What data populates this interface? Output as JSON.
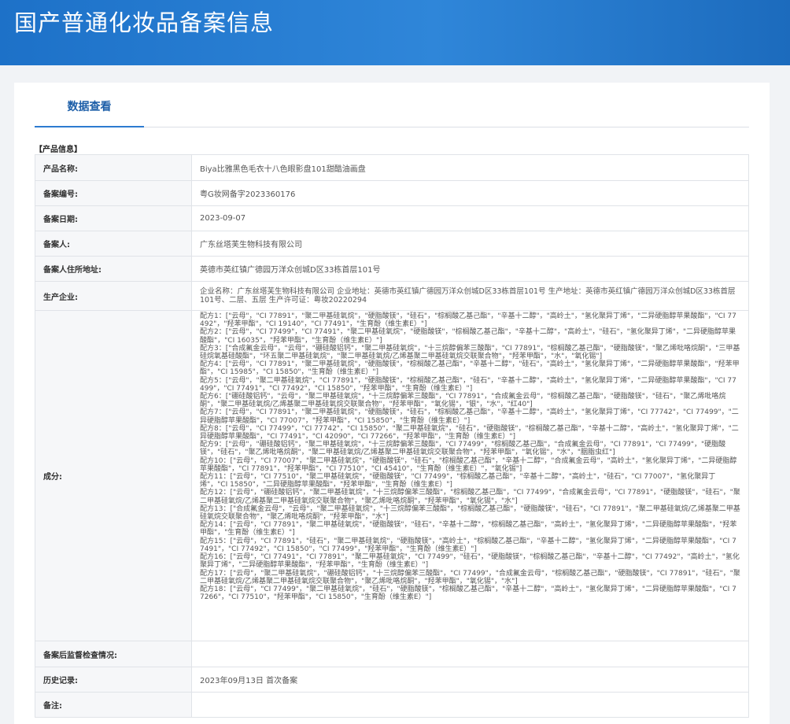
{
  "header": {
    "title": "国产普通化妆品备案信息"
  },
  "tabs": [
    {
      "label": "数据查看"
    }
  ],
  "section": {
    "title": "【产品信息】"
  },
  "fields": {
    "product_name": {
      "label": "产品名称:",
      "value": "Biya比雅黑色毛衣十八色眼影盘101甜酷油画盘"
    },
    "record_no": {
      "label": "备案编号:",
      "value": "粤G妆网备字2023360176"
    },
    "record_date": {
      "label": "备案日期:",
      "value": "2023-09-07"
    },
    "registrant": {
      "label": "备案人:",
      "value": "广东丝塔芙生物科技有限公司"
    },
    "address": {
      "label": "备案人住所地址:",
      "value": "英德市英红镇广德园万洋众创城D区33栋首层101号"
    },
    "manufacturer": {
      "label": "生产企业:",
      "value": "企业名称：广东丝塔芙生物科技有限公司 企业地址：英德市英红镇广德园万洋众创城D区33栋首层101号 生产地址：英德市英红镇广德园万洋众创城D区33栋首层101号、二层、五层 生产许可证：粤妆20220294"
    },
    "ingredients_label": "成分:",
    "supervision": {
      "label": "备案后监督检查情况:",
      "value": ""
    },
    "history": {
      "label": "历史记录:",
      "value": "2023年09月13日 首次备案"
    },
    "remarks": {
      "label": "备注:",
      "value": ""
    }
  },
  "ingredients": [
    "配方1：[\"云母\"，\"CI 77891\"，\"聚二甲基硅氧烷\"，\"硬脂酸镁\"，\"硅石\"，\"棕榈酸乙基己酯\"，\"辛基十二醇\"，\"高岭土\"，\"氢化聚异丁烯\"，\"二异硬脂醇苹果酸酯\"，\"CI 77492\"，\"羟苯甲酯\"，\"CI 19140\"，\"CI 77491\"，\"生育酚（维生素E）\"]",
    "配方2：[\"云母\"，\"CI 77499\"，\"CI 77491\"，\"聚二甲基硅氧烷\"，\"硬脂酸镁\"，\"棕榈酸乙基己酯\"，\"辛基十二醇\"，\"高岭土\"，\"硅石\"，\"氢化聚异丁烯\"，\"二异硬脂醇苹果酸酯\"，\"CI 16035\"，\"羟苯甲酯\"，\"生育酚（维生素E）\"]",
    "配方3：[\"合成氟金云母\"，\"云母\"，\"硼硅酸铝钙\"，\"聚二甲基硅氧烷\"，\"十三烷醇偏苯三酸酯\"，\"CI 77891\"，\"棕榈酸乙基己酯\"，\"硬脂酸镁\"，\"聚乙烯吡咯烷酮\"，\"三甲基硅烷氧基硅酸酯\"，\"环五聚二甲基硅氧烷\"，\"聚二甲基硅氧烷/乙烯基聚二甲基硅氧烷交联聚合物\"，\"羟苯甲酯\"，\"水\"，\"氧化锡\"]",
    "配方4：[\"云母\"，\"CI 77891\"，\"聚二甲基硅氧烷\"，\"硬脂酸镁\"，\"棕榈酸乙基己酯\"，\"辛基十二醇\"，\"硅石\"，\"高岭土\"，\"氢化聚异丁烯\"，\"二异硬脂醇苹果酸酯\"，\"羟苯甲酯\"，\"CI 15985\"，\"CI 15850\"，\"生育酚（维生素E）\"]",
    "配方5：[\"云母\"，\"聚二甲基硅氧烷\"，\"CI 77891\"，\"硬脂酸镁\"，\"棕榈酸乙基己酯\"，\"硅石\"，\"辛基十二醇\"，\"高岭土\"，\"氢化聚异丁烯\"，\"二异硬脂醇苹果酸酯\"，\"CI 77499\"，\"CI 77491\"，\"CI 77492\"，\"CI 15850\"，\"羟苯甲酯\"，\"生育酚（维生素E）\"]",
    "配方6：[\"硼硅酸铝钙\"，\"云母\"，\"聚二甲基硅氧烷\"，\"十三烷醇偏苯三酸酯\"，\"CI 77891\"，\"合成氟金云母\"，\"棕榈酸乙基己酯\"，\"硬脂酸镁\"，\"硅石\"，\"聚乙烯吡咯烷酮\"，\"聚二甲基硅氧烷/乙烯基聚二甲基硅氧烷交联聚合物\"，\"羟苯甲酯\"，\"氧化锡\"，\"银\"，\"水\"，\"红40\"]",
    "配方7：[\"云母\"，\"CI 77891\"，\"聚二甲基硅氧烷\"，\"硬脂酸镁\"，\"硅石\"，\"棕榈酸乙基己酯\"，\"辛基十二醇\"，\"高岭土\"，\"氢化聚异丁烯\"，\"CI 77742\"，\"CI 77499\"，\"二异硬脂醇苹果酸酯\"，\"CI 77007\"，\"羟苯甲酯\"，\"CI 15850\"，\"生育酚（维生素E）\"]",
    "配方8：[\"云母\"，\"CI 77499\"，\"CI 77742\"，\"CI 15850\"，\"聚二甲基硅氧烷\"，\"硅石\"，\"硬脂酸镁\"，\"棕榈酸乙基己酯\"，\"辛基十二醇\"，\"高岭土\"，\"氢化聚异丁烯\"，\"二异硬脂醇苹果酸酯\"，\"CI 77491\"，\"CI 42090\"，\"CI 77266\"，\"羟苯甲酯\"，\"生育酚（维生素E）\"]",
    "配方9：[\"云母\"，\"硼硅酸铝钙\"，\"聚二甲基硅氧烷\"，\"十三烷醇偏苯三酸酯\"，\"CI 77499\"，\"棕榈酸乙基己酯\"，\"合成氟金云母\"，\"CI 77891\"，\"CI 77499\"，\"硬脂酸镁\"，\"硅石\"，\"聚乙烯吡咯烷酮\"，\"聚二甲基硅氧烷/乙烯基聚二甲基硅氧烷交联聚合物\"，\"羟苯甲酯\"，\"氧化锡\"，\"水\"，\"胭脂虫红\"]",
    "配方10：[\"云母\"，\"CI 77007\"，\"聚二甲基硅氧烷\"，\"硬脂酸镁\"，\"硅石\"，\"棕榈酸乙基己酯\"，\"辛基十二醇\"，\"合成氟金云母\"，\"高岭土\"，\"氢化聚异丁烯\"，\"二异硬脂醇苹果酸酯\"，\"CI 77891\"，\"羟苯甲酯\"，\"CI 77510\"，\"CI 45410\"，\"生育酚（维生素E）\"，\"氧化锡\"]",
    "配方11：[\"云母\"，\"CI 77510\"，\"聚二甲基硅氧烷\"，\"硬脂酸镁\"，\"CI 77499\"，\"棕榈酸乙基己酯\"，\"辛基十二醇\"，\"高岭土\"，\"硅石\"，\"CI 77007\"，\"氢化聚异丁烯\"，\"CI 15850\"，\"二异硬脂醇苹果酸酯\"，\"羟苯甲酯\"，\"生育酚（维生素E）\"]",
    "配方12：[\"云母\"，\"硼硅酸铝钙\"，\"聚二甲基硅氧烷\"，\"十三烷醇偏苯三酸酯\"，\"棕榈酸乙基己酯\"，\"CI 77499\"，\"合成氟金云母\"，\"CI 77891\"，\"硬脂酸镁\"，\"硅石\"，\"聚二甲基硅氧烷/乙烯基聚二甲基硅氧烷交联聚合物\"，\"聚乙烯吡咯烷酮\"，\"羟苯甲酯\"，\"氧化锡\"，\"水\"]",
    "配方13：[\"合成氟金云母\"，\"云母\"，\"聚二甲基硅氧烷\"，\"十三烷醇偏苯三酸酯\"，\"棕榈酸乙基己酯\"，\"硬脂酸镁\"，\"硅石\"，\"CI 77891\"，\"聚二甲基硅氧烷/乙烯基聚二甲基硅氧烷交联聚合物\"，\"聚乙烯吡咯烷酮\"，\"羟苯甲酯\"，\"水\"]",
    "配方14：[\"云母\"，\"CI 77891\"，\"聚二甲基硅氧烷\"，\"硬脂酸镁\"，\"硅石\"，\"辛基十二醇\"，\"棕榈酸乙基己酯\"，\"高岭土\"，\"氢化聚异丁烯\"，\"二异硬脂醇苹果酸酯\"，\"羟苯甲酯\"，\"生育酚（维生素E）\"]",
    "配方15：[\"云母\"，\"CI 77891\"，\"硅石\"，\"聚二甲基硅氧烷\"，\"硬脂酸镁\"，\"高岭土\"，\"棕榈酸乙基己酯\"，\"辛基十二醇\"，\"氢化聚异丁烯\"，\"二异硬脂醇苹果酸酯\"，\"CI 77491\"，\"CI 77492\"，\"CI 15850\"，\"CI 77499\"，\"羟苯甲酯\"，\"生育酚（维生素E）\"]",
    "配方16：[\"云母\"，\"CI 77491\"，\"CI 77891\"，\"聚二甲基硅氧烷\"，\"CI 77499\"，\"硅石\"，\"硬脂酸镁\"，\"棕榈酸乙基己酯\"，\"辛基十二醇\"，\"CI 77492\"，\"高岭土\"，\"氢化聚异丁烯\"，\"二异硬脂醇苹果酸酯\"，\"羟苯甲酯\"，\"生育酚（维生素E）\"]",
    "配方17：[\"云母\"，\"聚二甲基硅氧烷\"，\"硼硅酸铝钙\"，\"十三烷醇偏苯三酸酯\"，\"CI 77499\"，\"合成氟金云母\"，\"棕榈酸乙基己酯\"，\"硬脂酸镁\"，\"CI 77891\"，\"硅石\"，\"聚二甲基硅氧烷/乙烯基聚二甲基硅氧烷交联聚合物\"，\"聚乙烯吡咯烷酮\"，\"羟苯甲酯\"，\"氧化锡\"，\"水\"]",
    "配方18：[\"云母\"，\"CI 77499\"，\"聚二甲基硅氧烷\"，\"硅石\"，\"硬脂酸镁\"，\"棕榈酸乙基己酯\"，\"辛基十二醇\"，\"高岭土\"，\"氢化聚异丁烯\"，\"二异硬脂醇苹果酸酯\"，\"CI 77266\"，\"CI 77510\"，\"羟苯甲酯\"，\"CI 15850\"，\"生育酚（维生素E）\"]"
  ]
}
